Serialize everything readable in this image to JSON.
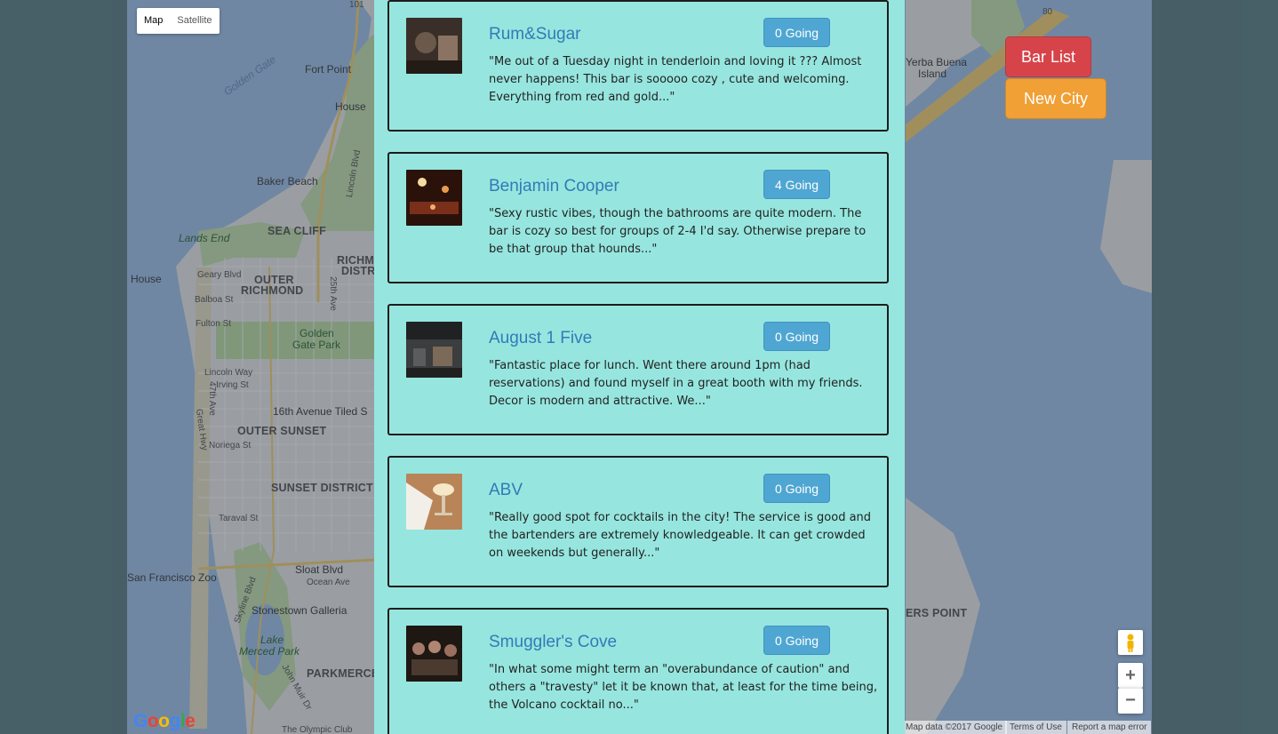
{
  "map": {
    "type_controls": [
      "Map",
      "Satellite"
    ],
    "labels": {
      "golden_gate": "Golden Gate",
      "fort_point": "Fort Point",
      "house_top": "House",
      "baker_beach": "Baker Beach",
      "lands_end": "Lands End",
      "sea_cliff": "SEA CLIFF",
      "richmond": "RICHMO",
      "richmond2": "DISTRI",
      "house_left": "House",
      "geary": "Geary Blvd",
      "outer_richmond": "OUTER",
      "outer_richmond2": "RICHMOND",
      "balboa": "Balboa St",
      "fulton": "Fulton St",
      "golden_gate_park": "Golden",
      "golden_gate_park2": "Gate Park",
      "lincoln_way": "Lincoln Way",
      "irving": "Irving St",
      "tiled_steps": "16th Avenue Tiled S",
      "outer_sunset": "OUTER SUNSET",
      "noriega": "Noriega St",
      "sunset_district": "SUNSET DISTRICT",
      "taraval": "Taraval St",
      "sloat": "Sloat Blvd",
      "ocean_ave": "Ocean Ave",
      "sf_zoo": "San Francisco Zoo",
      "stonestown": "Stonestown Galleria",
      "lake_merced": "Lake",
      "lake_merced2": "Merced Park",
      "parkmerced": "PARKMERCED",
      "olympic_club": "The Olympic Club",
      "yerba_buena": "Yerba Buena",
      "yerba_buena2": "Island",
      "hunters_point": "ERS POINT",
      "ave_25th": "25th Ave",
      "ave_47th": "47th Ave",
      "great_hwy": "Great Hwy",
      "lincoln_blvd": "Lincoln Blvd",
      "skyline": "Skyline Blvd",
      "john_muir": "John Muir Dr",
      "route_101": "101",
      "route_80": "80"
    },
    "logo": "Google",
    "attribution": [
      "Map data ©2017 Google",
      "Terms of Use",
      "Report a map error"
    ],
    "zoom_in": "+",
    "zoom_out": "−"
  },
  "buttons": {
    "bar_list": "Bar List",
    "new_city": "New City",
    "bar_list_color": "#d6444a",
    "new_city_color": "#f0a035"
  },
  "bars": [
    {
      "name": "Rum&Sugar",
      "going": "0 Going",
      "snippet": "\"Me out of a Tuesday night in tenderloin and loving it ??? Almost never happens! This bar is sooooo cozy , cute and welcoming. Everything from red and gold...\""
    },
    {
      "name": "Benjamin Cooper",
      "going": "4 Going",
      "snippet": "\"Sexy rustic vibes, though the bathrooms are quite modern. The bar is cozy so best for groups of 2-4 I'd say. Otherwise prepare to be that group that hounds...\""
    },
    {
      "name": "August 1 Five",
      "going": "0 Going",
      "snippet": "\"Fantastic place for lunch. Went there around 1pm (had reservations) and found myself in a great booth with my friends. Decor is modern and attractive. We...\""
    },
    {
      "name": "ABV",
      "going": "0 Going",
      "snippet": "\"Really good spot for cocktails in the city! The service is good and the bartenders are extremely knowledgeable. It can get crowded on weekends but generally...\""
    },
    {
      "name": "Smuggler's Cove",
      "going": "0 Going",
      "snippet": "\"In what some might term an \"overabundance of caution\" and others a \"travesty\" let it be known that, at least for the time being, the Volcano cocktail no...\""
    }
  ]
}
